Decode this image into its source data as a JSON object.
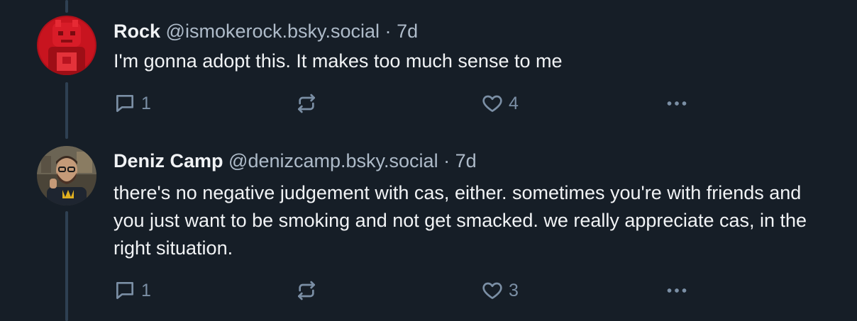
{
  "posts": [
    {
      "display_name": "Rock",
      "handle": "@ismokerock.bsky.social",
      "separator": "·",
      "time": "7d",
      "text": "I'm gonna adopt this. It makes too much sense to me",
      "reply_count": "1",
      "like_count": "4"
    },
    {
      "display_name": "Deniz Camp",
      "handle": "@denizcamp.bsky.social",
      "separator": "·",
      "time": "7d",
      "text": "there's no negative judgement with cas, either. sometimes you're with friends and you just want to be smoking and not get smacked. we really appreciate cas, in the right situation.",
      "reply_count": "1",
      "like_count": "3"
    }
  ],
  "icons": {
    "reply": "speech-bubble-icon",
    "repost": "repost-arrows-icon",
    "like": "heart-icon",
    "more": "ellipsis-icon"
  },
  "colors": {
    "background": "#161e27",
    "thread_line": "#2e4052",
    "text_primary": "#f1f3f5",
    "text_secondary": "#aebbc9",
    "icon": "#7b8fa5"
  }
}
